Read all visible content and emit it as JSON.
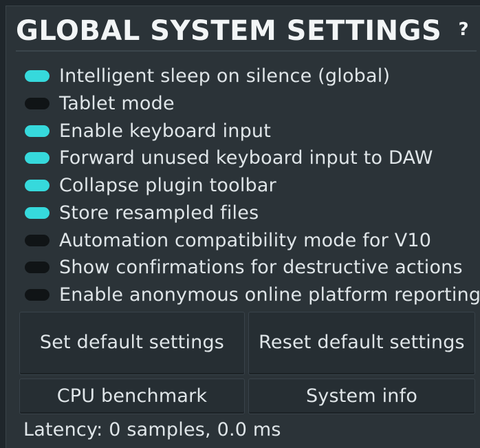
{
  "panel": {
    "title": "GLOBAL SYSTEM SETTINGS",
    "help_label": "?"
  },
  "colors": {
    "toggle_on": "#36d9dc",
    "toggle_off": "#101416",
    "panel_bg": "#2b3338"
  },
  "options": [
    {
      "label": "Intelligent sleep on silence (global)",
      "enabled": true
    },
    {
      "label": "Tablet mode",
      "enabled": false
    },
    {
      "label": "Enable keyboard input",
      "enabled": true
    },
    {
      "label": "Forward unused keyboard input to DAW",
      "enabled": true
    },
    {
      "label": "Collapse plugin toolbar",
      "enabled": true
    },
    {
      "label": "Store resampled files",
      "enabled": true
    },
    {
      "label": "Automation compatibility mode for V10",
      "enabled": false
    },
    {
      "label": "Show confirmations for destructive actions",
      "enabled": false
    },
    {
      "label": "Enable anonymous online platform reporting",
      "enabled": false
    }
  ],
  "buttons": {
    "set_default": "Set default settings",
    "reset_default": "Reset default settings",
    "cpu_benchmark": "CPU benchmark",
    "system_info": "System info"
  },
  "status": {
    "latency": "Latency: 0 samples, 0.0 ms"
  }
}
